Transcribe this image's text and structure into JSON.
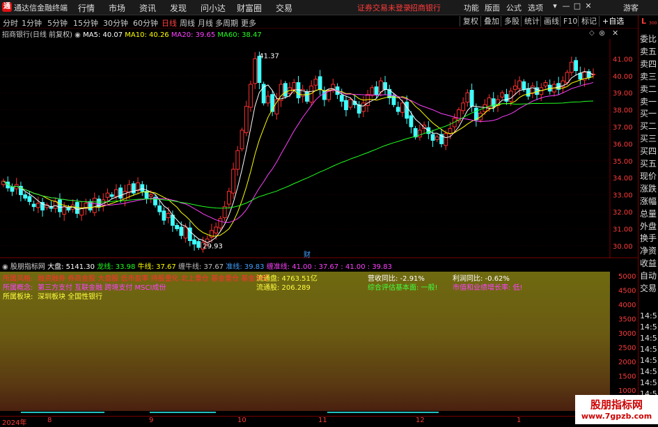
{
  "app": {
    "title": "通达信金融终端",
    "logo_glyph": "通"
  },
  "menu": [
    "行情",
    "市场",
    "资讯",
    "发现",
    "问小达",
    "财富圈",
    "交易"
  ],
  "menu_alert": [
    "证券交易未登录",
    "招商银行"
  ],
  "menu_right": [
    "功能",
    "版面",
    "公式",
    "选项",
    "游客"
  ],
  "win_controls": [
    "▾",
    "—",
    "□",
    "✕"
  ],
  "periods": [
    "分时",
    "1分钟",
    "5分钟",
    "15分钟",
    "30分钟",
    "60分钟",
    "日线",
    "周线",
    "月线",
    "多周期",
    "更多"
  ],
  "active_period": "日线",
  "toolbar_right": [
    "复权",
    "叠加",
    "多股",
    "统计",
    "画线",
    "F10",
    "标记",
    "+自选"
  ],
  "right_col": {
    "top": "L",
    "top_sub": "300",
    "items": [
      "委比",
      "卖五",
      "卖四",
      "卖三",
      "卖二",
      "卖一",
      "买一",
      "买二",
      "买三",
      "买四",
      "买五",
      "现价",
      "涨跌",
      "涨幅",
      "总量",
      "外盘",
      "换手",
      "净资",
      "收益",
      "自动",
      "交易"
    ],
    "times": [
      "14:5",
      "14:5",
      "14:5",
      "14:5",
      "14:5",
      "14:5",
      "14:5",
      "14:5",
      "14:5",
      "14:5"
    ]
  },
  "info": {
    "stock": "招商银行(日线 前复权)",
    "ma5": "MA5: 40.07",
    "ma10": "MA10: 40.26",
    "ma20": "MA20: 39.65",
    "ma60": "MA60: 38.47",
    "colors": {
      "ma5": "#ffffff",
      "ma10": "#ffff00",
      "ma20": "#ff40ff",
      "ma60": "#20ff20"
    }
  },
  "chart_data": {
    "type": "candlestick",
    "ylim": [
      29.5,
      42
    ],
    "yticks": [
      "41.00",
      "40.00",
      "39.00",
      "38.00",
      "37.00",
      "36.00",
      "35.00",
      "34.00",
      "33.00",
      "32.00",
      "31.00",
      "30.00"
    ],
    "annotations": {
      "high": "41.37",
      "low": "29.93",
      "marker": "财"
    },
    "closes": [
      33.8,
      33.4,
      33.2,
      33.6,
      33.0,
      32.8,
      32.6,
      32.3,
      32.5,
      32.1,
      32.4,
      32.2,
      32.6,
      32.0,
      32.3,
      32.1,
      32.4,
      31.9,
      32.2,
      32.5,
      32.1,
      32.8,
      32.3,
      32.7,
      33.1,
      32.9,
      33.3,
      32.8,
      33.2,
      33.6,
      33.1,
      33.7,
      33.2,
      32.8,
      33.0,
      32.4,
      32.0,
      31.5,
      31.9,
      31.2,
      31.0,
      30.6,
      31.1,
      30.3,
      30.1,
      29.9,
      30.2,
      30.4,
      30.9,
      31.1,
      31.6,
      32.3,
      33.2,
      34.5,
      35.6,
      36.8,
      38.2,
      39.5,
      41.0,
      39.6,
      38.4,
      38.8,
      37.9,
      38.6,
      39.5,
      38.8,
      39.3,
      39.6,
      38.7,
      39.2,
      38.5,
      39.4,
      39.8,
      39.2,
      38.6,
      39.1,
      39.5,
      38.9,
      38.5,
      38.0,
      38.6,
      38.3,
      37.8,
      38.4,
      38.9,
      39.3,
      38.9,
      39.7,
      39.2,
      38.7,
      38.3,
      37.9,
      38.4,
      37.5,
      37.0,
      36.4,
      36.8,
      37.1,
      36.6,
      36.2,
      36.4,
      36.0,
      36.6,
      36.9,
      37.5,
      38.0,
      38.4,
      39.0,
      38.2,
      37.4,
      37.8,
      38.3,
      38.7,
      38.2,
      38.6,
      39.0,
      38.5,
      39.1,
      39.4,
      39.7,
      39.2,
      38.8,
      39.4,
      38.9,
      39.3,
      39.6,
      39.1,
      39.5,
      39.2,
      39.7,
      40.2,
      40.8,
      40.3,
      39.8,
      40.2,
      39.9,
      40.1
    ]
  },
  "panel": {
    "title": "股朋指标网",
    "dapan": "大盘: 5141.30",
    "long": "龙线: 33.98",
    "bull": "牛线: 37.67",
    "entangle": "缠牛线: 37.67",
    "quasi": "准线: 39.83",
    "quasi_ent": "缠准线: 41.00 : 37.67 : 41.00 : 39.83",
    "row1_label": "所属风格:",
    "row1_val": "融资融券 券商金股 大盘股 低市盈率 持股量化 北上重仓 基金重仓 基金净增",
    "row2_label": "所属概念:",
    "row2_val": "第三方支付 互联金融 跨境支付 MSCI成份",
    "row3_label": "所属板块:",
    "row3_val": "深圳板块 全国性银行",
    "float": "流通盘: 4763.51亿",
    "float2": "流通股: 206.289",
    "rev": "营收同比: -2.91%",
    "profit": "利润同比: -0.62%",
    "eval": "综合评估基本面: 一般!",
    "eval2": "市值和业绩增长率: 低!",
    "y_ticks": [
      "5000",
      "4500",
      "4000",
      "3500",
      "3000",
      "2500",
      "2000",
      "1500",
      "1000",
      "500"
    ]
  },
  "dates": [
    "2024年",
    "8",
    "9",
    "10",
    "11",
    "12",
    "1"
  ],
  "watermark": {
    "line1": "股朋指标网",
    "line2": "www.7gpzb.com"
  }
}
